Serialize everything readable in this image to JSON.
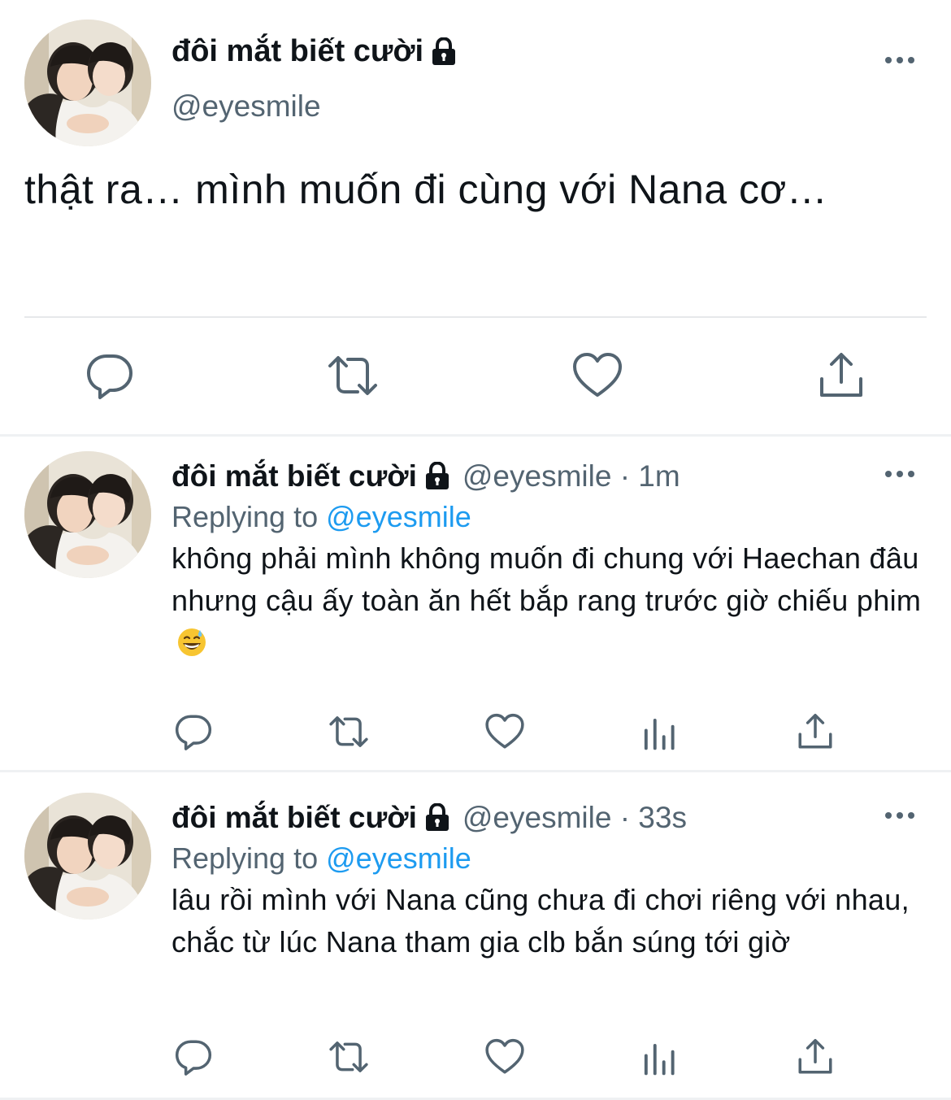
{
  "main_tweet": {
    "display_name": "đôi mắt biết cười",
    "handle": "@eyesmile",
    "text": "thật ra… mình muốn đi cùng với Nana cơ…",
    "icons": [
      "avatar",
      "lock-icon",
      "more-icon",
      "reply-icon",
      "retweet-icon",
      "like-icon",
      "share-icon"
    ]
  },
  "replies": [
    {
      "display_name": "đôi mắt biết cười",
      "meta": "@eyesmile · 1m",
      "replying_prefix": "Replying to",
      "replying_to": "@eyesmile",
      "text": "không phải mình không muốn đi chung với Haechan đâu nhưng cậu ấy toàn ăn hết bắp rang trước giờ chiếu phim",
      "emoji": "grinning-face-with-sweat-emoji"
    },
    {
      "display_name": "đôi mắt biết cười",
      "meta": "@eyesmile · 33s",
      "replying_prefix": "Replying to",
      "replying_to": "@eyesmile",
      "text": "lâu rồi mình với Nana cũng chưa đi chơi riêng với nhau, chắc từ lúc Nana tham gia clb bắn súng tới giờ"
    }
  ],
  "colors": {
    "text": "#0f1419",
    "secondary": "#536471",
    "accent": "#1d9bf0",
    "divider": "#eff1f3"
  }
}
